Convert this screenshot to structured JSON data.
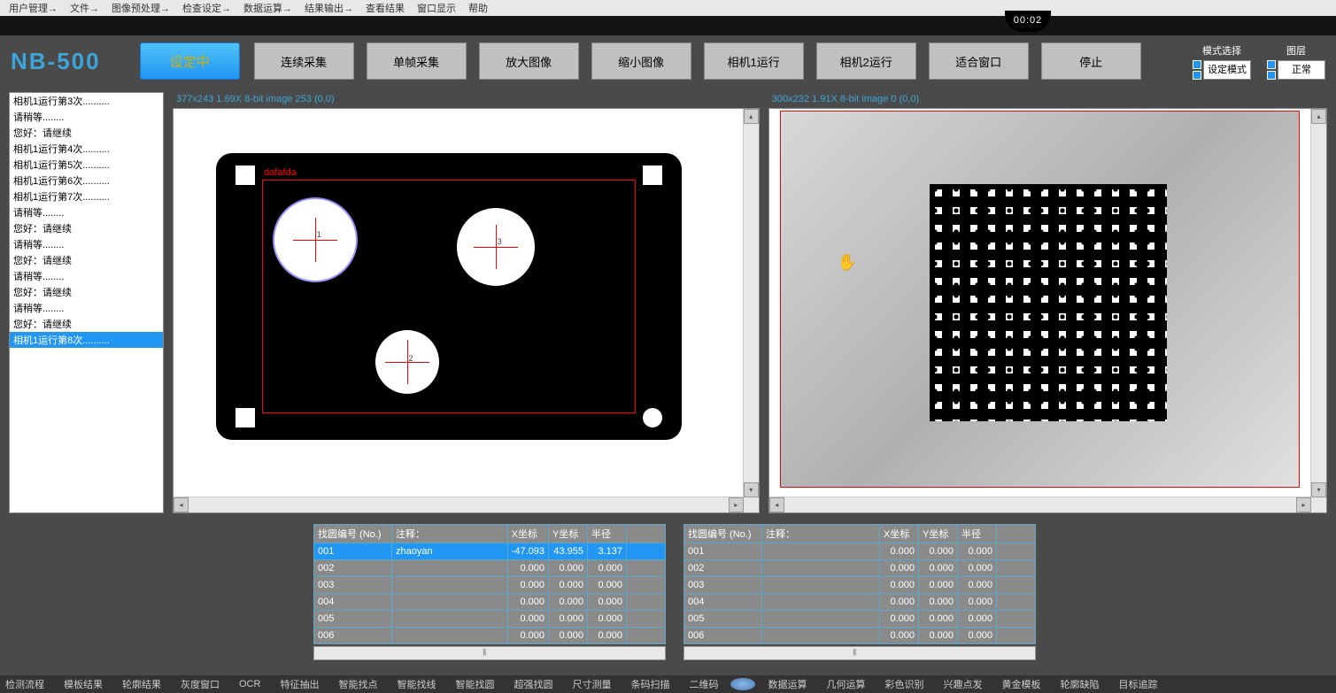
{
  "menu": [
    "用户管理→",
    "文件→",
    "图像预处理→",
    "检查设定→",
    "数据运算→",
    "结果输出→",
    "查看结果",
    "窗口显示",
    "帮助"
  ],
  "timer": "00:02",
  "logo": "NB-500",
  "toolbar": {
    "main": "设定中",
    "btns": [
      "连续采集",
      "单帧采集",
      "放大图像",
      "缩小图像",
      "相机1运行",
      "相机2运行",
      "适合窗口",
      "停止"
    ]
  },
  "mode": {
    "label": "模式选择",
    "value": "设定模式",
    "layer_label": "图层",
    "layer_value": "正常"
  },
  "log": [
    "相机1运行第3次..........",
    "请稍等........",
    "您好：请继续",
    "相机1运行第4次..........",
    "相机1运行第5次..........",
    "相机1运行第6次..........",
    "相机1运行第7次..........",
    "请稍等........",
    "您好：请继续",
    "请稍等........",
    "您好：请继续",
    "请稍等........",
    "您好：请继续",
    "请稍等........",
    "您好：请继续",
    "相机1运行第8次.........."
  ],
  "log_selected": 15,
  "view1_info": "377x243 1.69X 8-bit image 253    (0,0)",
  "view2_info": "300x232 1.91X 8-bit image 0     (0,0)",
  "roi_label": "dafafda",
  "table_headers": [
    "找圆编号 (No.)",
    "注释：",
    "X坐标",
    "Y坐标",
    "半径"
  ],
  "table1": [
    {
      "no": "001",
      "note": "zhaoyan",
      "x": "-47.093",
      "y": "43.955",
      "r": "3.137",
      "sel": true
    },
    {
      "no": "002",
      "note": "",
      "x": "0.000",
      "y": "0.000",
      "r": "0.000"
    },
    {
      "no": "003",
      "note": "",
      "x": "0.000",
      "y": "0.000",
      "r": "0.000"
    },
    {
      "no": "004",
      "note": "",
      "x": "0.000",
      "y": "0.000",
      "r": "0.000"
    },
    {
      "no": "005",
      "note": "",
      "x": "0.000",
      "y": "0.000",
      "r": "0.000"
    },
    {
      "no": "006",
      "note": "",
      "x": "0.000",
      "y": "0.000",
      "r": "0.000"
    }
  ],
  "table2": [
    {
      "no": "001",
      "note": "",
      "x": "0.000",
      "y": "0.000",
      "r": "0.000"
    },
    {
      "no": "002",
      "note": "",
      "x": "0.000",
      "y": "0.000",
      "r": "0.000"
    },
    {
      "no": "003",
      "note": "",
      "x": "0.000",
      "y": "0.000",
      "r": "0.000"
    },
    {
      "no": "004",
      "note": "",
      "x": "0.000",
      "y": "0.000",
      "r": "0.000"
    },
    {
      "no": "005",
      "note": "",
      "x": "0.000",
      "y": "0.000",
      "r": "0.000"
    },
    {
      "no": "006",
      "note": "",
      "x": "0.000",
      "y": "0.000",
      "r": "0.000"
    }
  ],
  "status": [
    "检测流程",
    "模板结果",
    "轮廓结果",
    "灰度窗口",
    "OCR",
    "特征抽出",
    "智能找点",
    "智能找线",
    "智能找圆",
    "超强找圆",
    "尺寸测量",
    "条码扫描",
    "二维码",
    "数据运算",
    "几何运算",
    "彩色识别",
    "兴趣点发",
    "黄金模板",
    "轮廓缺陷",
    "目标追踪"
  ]
}
